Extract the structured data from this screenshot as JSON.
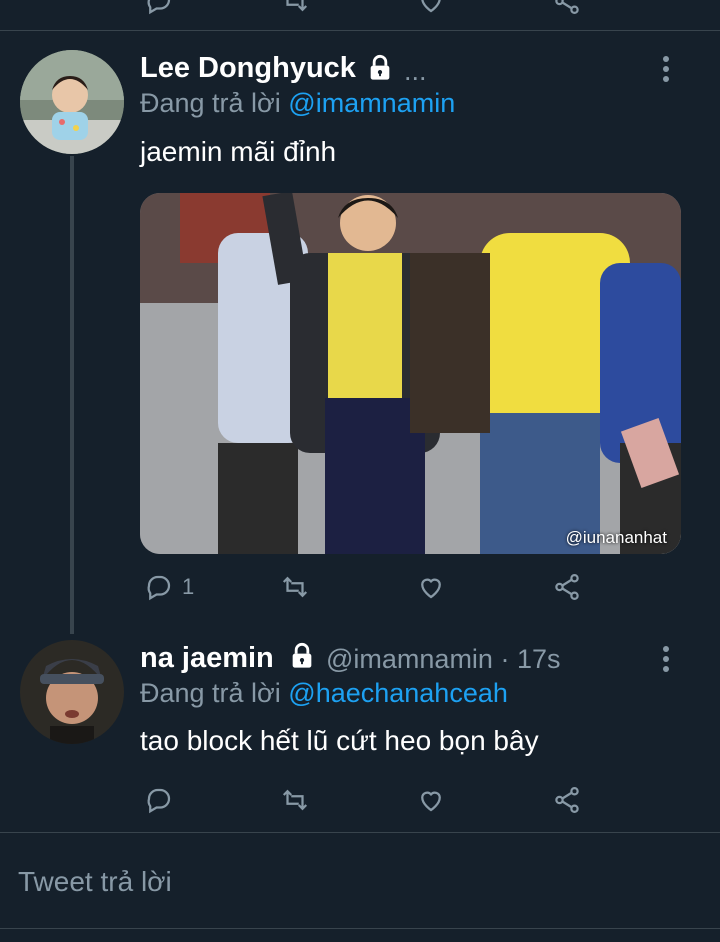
{
  "tweet1": {
    "name": "Lee Donghyuck",
    "ellipsis": "...",
    "replying_prefix": "Đang trả lời",
    "replying_to": "@imamnamin",
    "text": "jaemin mãi đỉnh",
    "media_watermark": "@iunananhat",
    "reply_count": "1"
  },
  "tweet2": {
    "name": "na jaemin",
    "handle": "@imamnamin · 17s",
    "replying_prefix": "Đang trả lời",
    "replying_to": "@haechanahceah",
    "text": "tao block hết lũ cứt heo bọn bây"
  },
  "compose": {
    "placeholder": "Tweet trả lời"
  },
  "colors": {
    "background": "#15202b",
    "divider": "#38444d",
    "muted": "#8899a6",
    "link": "#1da1f2"
  }
}
